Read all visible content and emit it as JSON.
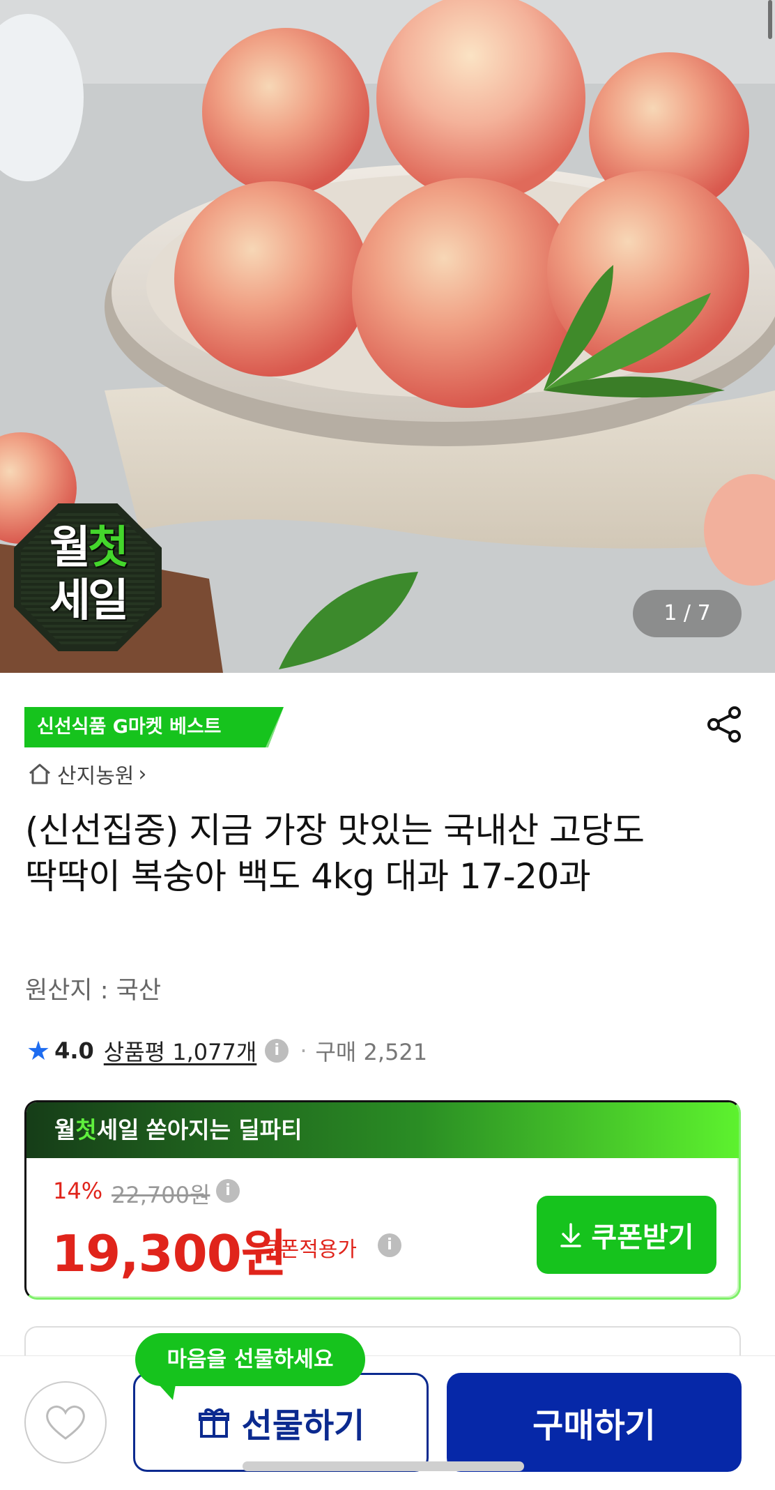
{
  "hero": {
    "badge_line1_a": "월",
    "badge_line1_b": "첫",
    "badge_line2": "세일",
    "counter": "1 / 7"
  },
  "product": {
    "best_tag": "신선식품 G마켓 베스트",
    "seller": "산지농원",
    "seller_chevron": "›",
    "title": "(신선집중) 지금 가장 맛있는 국내산 고당도 딱딱이 복숭아 백도 4kg 대과 17-20과",
    "origin": "원산지 : 국산",
    "rating_score": "4.0",
    "review_label": "상품평 1,077개",
    "purchase_label": "구매 2,521"
  },
  "deal": {
    "head_a": "월",
    "head_b": "첫",
    "head_c": "세일",
    "head_sub": "쏟아지는 딜파티",
    "discount": "14%",
    "original_price": "22,700원",
    "price": "19,300원",
    "coupon_price_label": "쿠폰적용가",
    "coupon_button": "쿠폰받기"
  },
  "bottom": {
    "tooltip": "마음을 선물하세요",
    "gift_button": "선물하기",
    "buy_button": "구매하기"
  },
  "colors": {
    "green": "#16c31d",
    "red": "#e0241b",
    "navy": "#0628a8",
    "star_blue": "#1e6cf0"
  }
}
